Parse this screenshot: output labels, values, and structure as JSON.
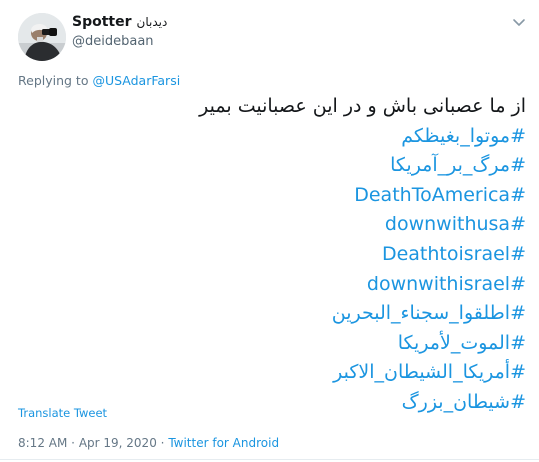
{
  "author": {
    "name": "Spotter",
    "name_fa": "دیدبان",
    "handle": "@deidebaan"
  },
  "reply": {
    "prefix": "Replying to",
    "mention": "@USAdarFarsi"
  },
  "tweet": {
    "text": "از ما عصبانی باش و در این عصبانیت بمیر",
    "hashtags": [
      "#موتوا_بغيظكم",
      "#مرگ_بر_آمریکا",
      "#DeathToAmerica",
      "#downwithusa",
      "#Deathtoisrael",
      "#downwithisrael",
      "#اطلقوا_سجناء_البحرين",
      "#الموت_لأمريكا",
      "#أمريكا_الشيطان_الاكبر",
      "#شیطان_بزرگ"
    ]
  },
  "translate_label": "Translate Tweet",
  "meta": {
    "time": "8:12 AM",
    "separator": "·",
    "date": "Apr 19, 2020",
    "source": "Twitter for Android"
  },
  "icons": {
    "caret": "chevron-down-icon",
    "avatar": "profile-photo"
  },
  "colors": {
    "link": "#1b95e0",
    "muted": "#657786",
    "text": "#14171a"
  }
}
